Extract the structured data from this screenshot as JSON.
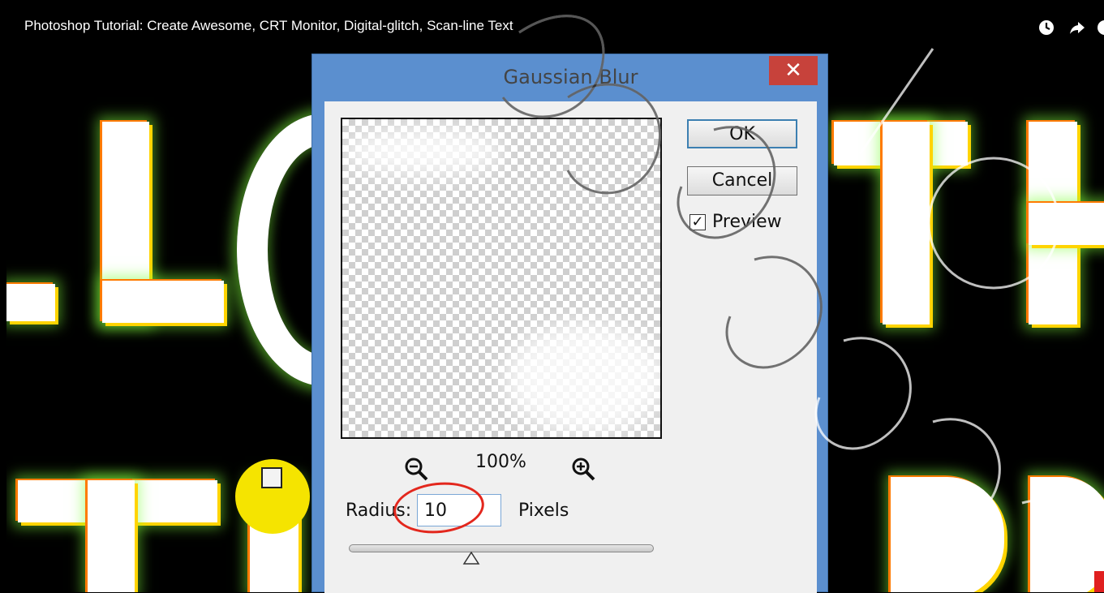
{
  "video": {
    "title": "Photoshop Tutorial: Create Awesome, CRT Monitor, Digital-glitch, Scan-line Text",
    "icons": [
      "clock-icon",
      "share-arrow-icon",
      "info-icon"
    ]
  },
  "dialog": {
    "title": "Gaussian Blur",
    "close_label": "✕",
    "ok_label": "OK",
    "cancel_label": "Cancel",
    "preview_label": "Preview",
    "preview_checked": true,
    "checkmark": "✓",
    "zoom_level": "100%",
    "radius_label": "Radius:",
    "radius_value": "10",
    "pixels_label": "Pixels",
    "slider_value_fraction": 0.4
  },
  "colors": {
    "dialog_frame": "#5b8fcf",
    "close_button": "#c7423b",
    "annotation_circle": "#e3271d",
    "glow": "#82ff3c"
  }
}
